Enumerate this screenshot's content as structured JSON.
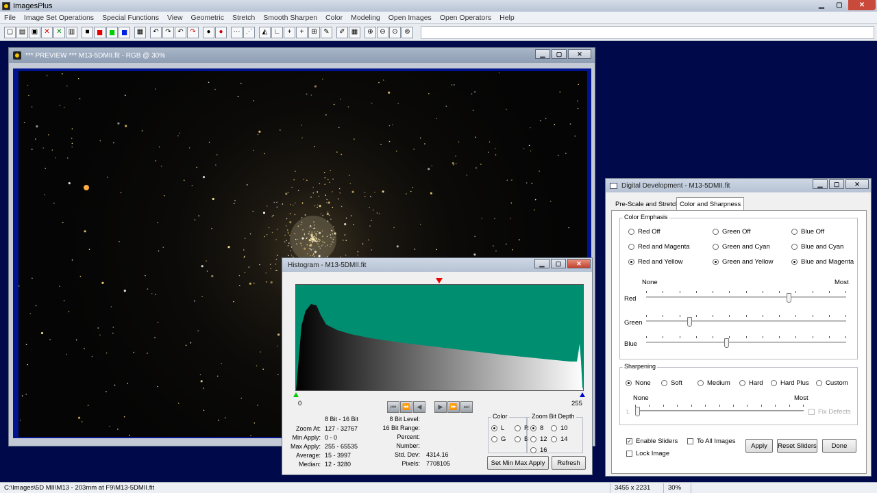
{
  "app": {
    "title": "ImagesPlus",
    "controls": {
      "minimize": "▁",
      "maximize": "▢",
      "close": "✕"
    }
  },
  "menu": [
    "File",
    "Image Set Operations",
    "Special Functions",
    "View",
    "Geometric",
    "Stretch",
    "Smooth Sharpen",
    "Color",
    "Modeling",
    "Open Images",
    "Open Operators",
    "Help"
  ],
  "toolbar": {
    "icons": [
      "new-file-icon",
      "open-folder-icon",
      "save-icon",
      "close-red-x-icon",
      "close-green-x-icon",
      "copy-icon",
      "rgb-channels-icon",
      "red-channel-icon",
      "green-channel-icon",
      "blue-channel-icon",
      "grid-icon",
      "undo-icon",
      "redo-icon",
      "undo-red-icon",
      "redo-red-icon",
      "point-icon",
      "point-red-icon",
      "dotted-line-icon",
      "selection-icon",
      "levels-icon",
      "crop-icon",
      "crosshair-icon",
      "plus-crosshair-icon",
      "grid-overlay-icon",
      "paint-icon",
      "pencil-icon",
      "table-icon",
      "zoom-in-icon",
      "zoom-out-icon",
      "zoom-fit-icon",
      "zoom-actual-icon"
    ],
    "glyphs": [
      "▢",
      "▤",
      "▣",
      "✕",
      "✕",
      "▥",
      "■",
      "■",
      "■",
      "■",
      "▦",
      "↶",
      "↷",
      "↶",
      "↷",
      "●",
      "●",
      "⋯",
      "⋰",
      "◭",
      "∟",
      "+",
      "+",
      "⊞",
      "✎",
      "✐",
      "▦",
      "⊕",
      "⊖",
      "⊙",
      "⊚"
    ],
    "colors": {
      "red": "#e60000",
      "green": "#00d000",
      "blue": "#0020e0"
    }
  },
  "preview": {
    "title": "*** PREVIEW *** M13-5DMII.fit - RGB @ 30%",
    "controls": {
      "minimize": "▁",
      "maximize": "▢",
      "close": "✕"
    }
  },
  "histogram": {
    "title": "Histogram - M13-5DMII.fit",
    "controls": {
      "minimize": "▁",
      "maximize": "▢",
      "close": "✕"
    },
    "axis_min": "0",
    "axis_max": "255",
    "nav_buttons": [
      "⏮",
      "⏪",
      "◀",
      "▶",
      "⏩",
      "⏭"
    ],
    "stats_header": "8 Bit - 16 Bit",
    "stats": [
      {
        "label": "Zoom At:",
        "value": "127 - 32767"
      },
      {
        "label": "Min Apply:",
        "value": "0 - 0"
      },
      {
        "label": "Max Apply:",
        "value": "255 - 65535"
      },
      {
        "label": "Average:",
        "value": "15 - 3997"
      },
      {
        "label": "Median:",
        "value": "12 - 3280"
      }
    ],
    "levels": [
      {
        "label": "8 Bit Level:",
        "value": ""
      },
      {
        "label": "16 Bit Range:",
        "value": ""
      },
      {
        "label": "Percent:",
        "value": ""
      },
      {
        "label": "Number:",
        "value": ""
      },
      {
        "label": "Std. Dev:",
        "value": "4314.16"
      },
      {
        "label": "Pixels:",
        "value": "7708105"
      }
    ],
    "color_group": {
      "caption": "Color",
      "options": [
        {
          "label": "L",
          "checked": true
        },
        {
          "label": "R",
          "checked": false
        },
        {
          "label": "G",
          "checked": false
        },
        {
          "label": "B",
          "checked": false
        }
      ]
    },
    "zoom_group": {
      "caption": "Zoom Bit Depth",
      "options": [
        {
          "label": "8",
          "checked": true
        },
        {
          "label": "10",
          "checked": false
        },
        {
          "label": "12",
          "checked": false
        },
        {
          "label": "14",
          "checked": false
        },
        {
          "label": "16",
          "checked": false
        }
      ]
    },
    "set_button": "Set Min Max Apply",
    "refresh_button": "Refresh",
    "curve_colors": {
      "background": "#008e70"
    }
  },
  "digital_development": {
    "title": "Digital Development - M13-5DMII.fit",
    "controls": {
      "minimize": "▁",
      "maximize": "▢",
      "close": "✕"
    },
    "tabs": [
      "Pre-Scale and Stretch",
      "Color and Sharpness"
    ],
    "color_emphasis": {
      "caption": "Color Emphasis",
      "options": [
        {
          "label": "Red Off",
          "checked": false
        },
        {
          "label": "Green Off",
          "checked": false
        },
        {
          "label": "Blue Off",
          "checked": false
        },
        {
          "label": "Red and Magenta",
          "checked": false
        },
        {
          "label": "Green and Cyan",
          "checked": false
        },
        {
          "label": "Blue and Cyan",
          "checked": false
        },
        {
          "label": "Red and Yellow",
          "checked": true
        },
        {
          "label": "Green and Yellow",
          "checked": true
        },
        {
          "label": "Blue and Magenta",
          "checked": true
        }
      ]
    },
    "slider_scale": {
      "min": "None",
      "max": "Most"
    },
    "sliders": [
      {
        "label": "Red",
        "value": 0.72
      },
      {
        "label": "Green",
        "value": 0.21
      },
      {
        "label": "Blue",
        "value": 0.4
      }
    ],
    "sharpening": {
      "caption": "Sharpening",
      "options": [
        {
          "label": "None",
          "checked": true
        },
        {
          "label": "Soft",
          "checked": false
        },
        {
          "label": "Medium",
          "checked": false
        },
        {
          "label": "Hard",
          "checked": false
        },
        {
          "label": "Hard Plus",
          "checked": false
        },
        {
          "label": "Custom",
          "checked": false
        }
      ],
      "scale": {
        "min": "None",
        "max": "Most",
        "start": "L"
      },
      "slider_value": 0.0,
      "fix_defects": "Fix Defects"
    },
    "enable_sliders": {
      "label": "Enable Sliders",
      "checked": true
    },
    "to_all_images": {
      "label": "To All Images",
      "checked": false
    },
    "lock_image": {
      "label": "Lock Image",
      "checked": false
    },
    "check_mark": "✓",
    "buttons": {
      "apply": "Apply",
      "reset": "Reset Sliders",
      "done": "Done"
    }
  },
  "status": {
    "path": "C:\\Images\\5D MII\\M13 - 203mm at F9\\M13-5DMII.fit",
    "dimensions": "3455 x 2231",
    "zoom": "30%"
  }
}
